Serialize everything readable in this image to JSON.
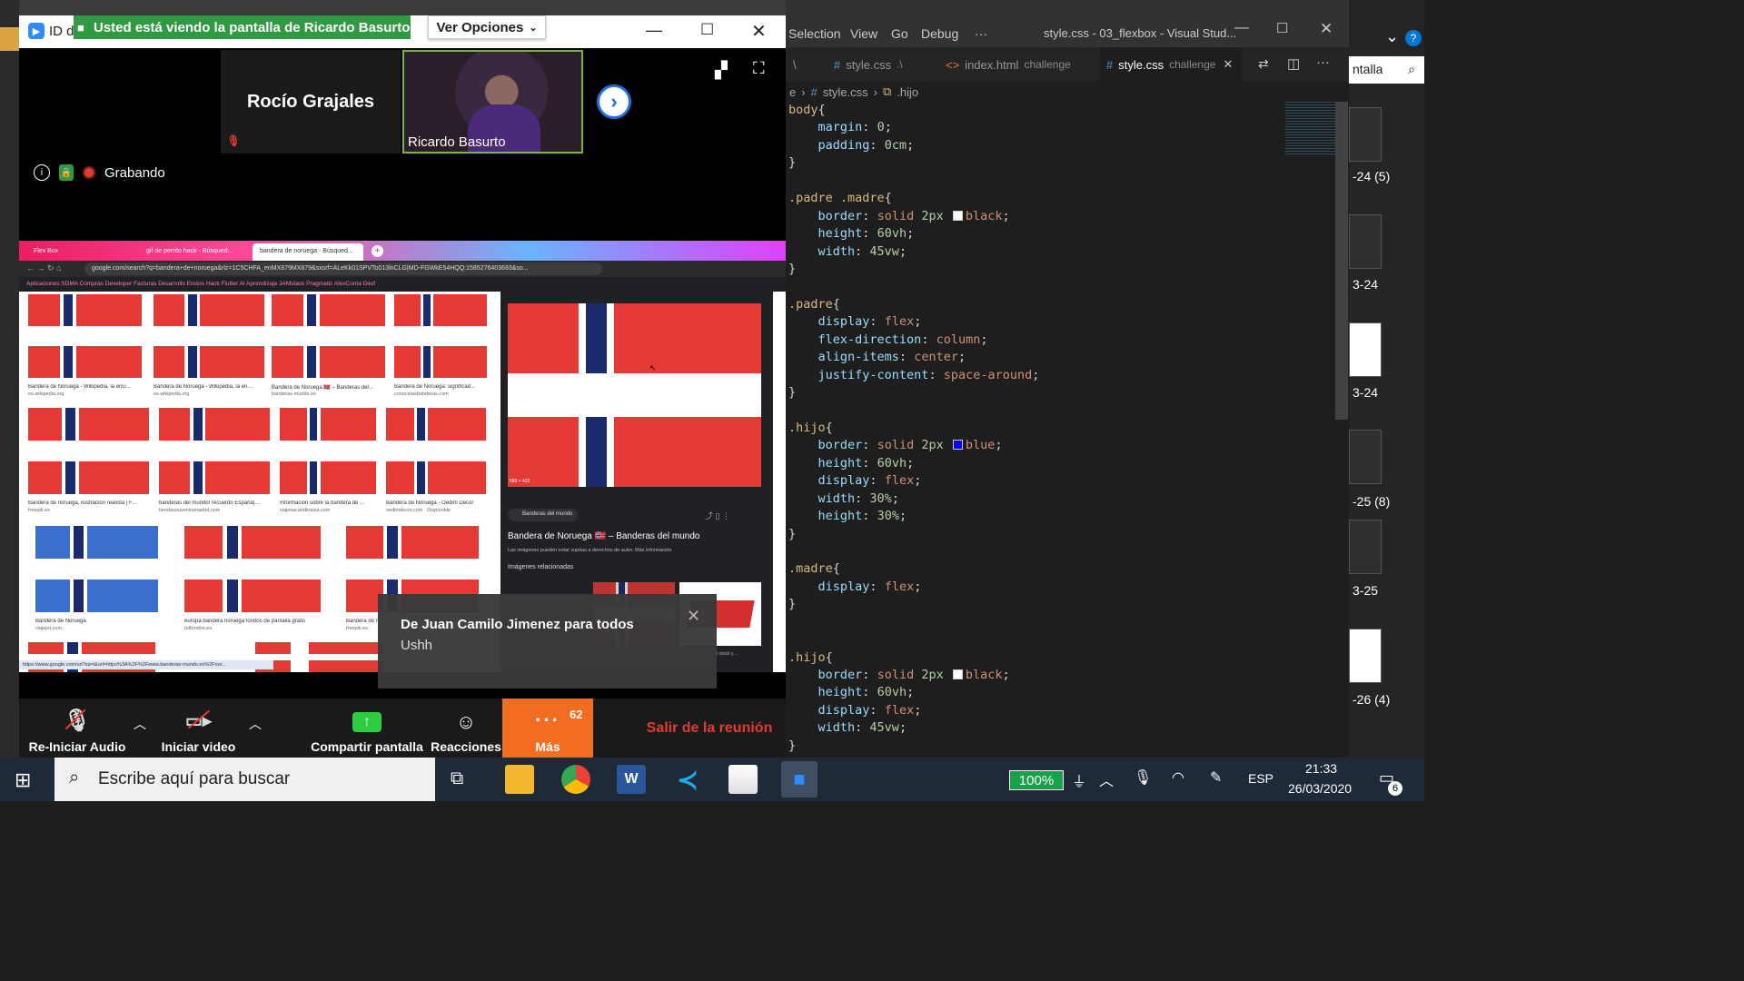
{
  "vscode": {
    "menu": [
      "Selection",
      "View",
      "Go",
      "Debug",
      "···"
    ],
    "title": "style.css - 03_flexbox - Visual Stud...",
    "tabs": [
      {
        "label": "\\",
        "desc": ""
      },
      {
        "label": "style.css",
        "desc": ".\\"
      },
      {
        "label": "index.html",
        "desc": "challenge"
      },
      {
        "label": "style.css",
        "desc": "challenge"
      }
    ],
    "breadcrumb": [
      "e",
      "style.css",
      ".hijo"
    ],
    "side_labels": [
      "ntalla",
      "-24 (5)",
      "3-24",
      "3-24",
      "-25 (8)",
      "3-25",
      "-26 (4)"
    ],
    "code": [
      [
        [
          "k",
          "body"
        ],
        [
          "w",
          "{"
        ]
      ],
      [
        [
          "w",
          "    "
        ],
        [
          "p",
          "margin"
        ],
        [
          "w",
          ": "
        ],
        [
          "n",
          "0"
        ],
        [
          "w",
          ";"
        ]
      ],
      [
        [
          "w",
          "    "
        ],
        [
          "p",
          "padding"
        ],
        [
          "w",
          ": "
        ],
        [
          "n",
          "0cm"
        ],
        [
          "w",
          ";"
        ]
      ],
      [
        [
          "w",
          "}"
        ]
      ],
      [
        [
          "w",
          ""
        ]
      ],
      [
        [
          "k",
          ".padre .madre"
        ],
        [
          "w",
          "{"
        ]
      ],
      [
        [
          "w",
          "    "
        ],
        [
          "p",
          "border"
        ],
        [
          "w",
          ": "
        ],
        [
          "v",
          "solid "
        ],
        [
          "n",
          "2px "
        ],
        [
          "sw",
          "#ffffff"
        ],
        [
          "v",
          "black"
        ],
        [
          "w",
          ";"
        ]
      ],
      [
        [
          "w",
          "    "
        ],
        [
          "p",
          "height"
        ],
        [
          "w",
          ": "
        ],
        [
          "n",
          "60vh"
        ],
        [
          "w",
          ";"
        ]
      ],
      [
        [
          "w",
          "    "
        ],
        [
          "p",
          "width"
        ],
        [
          "w",
          ": "
        ],
        [
          "n",
          "45vw"
        ],
        [
          "w",
          ";"
        ]
      ],
      [
        [
          "w",
          "}"
        ]
      ],
      [
        [
          "w",
          ""
        ]
      ],
      [
        [
          "k",
          ".padre"
        ],
        [
          "w",
          "{"
        ]
      ],
      [
        [
          "w",
          "    "
        ],
        [
          "p",
          "display"
        ],
        [
          "w",
          ": "
        ],
        [
          "v",
          "flex"
        ],
        [
          "w",
          ";"
        ]
      ],
      [
        [
          "w",
          "    "
        ],
        [
          "p",
          "flex-direction"
        ],
        [
          "w",
          ": "
        ],
        [
          "v",
          "column"
        ],
        [
          "w",
          ";"
        ]
      ],
      [
        [
          "w",
          "    "
        ],
        [
          "p",
          "align-items"
        ],
        [
          "w",
          ": "
        ],
        [
          "v",
          "center"
        ],
        [
          "w",
          ";"
        ]
      ],
      [
        [
          "w",
          "    "
        ],
        [
          "p",
          "justify-content"
        ],
        [
          "w",
          ": "
        ],
        [
          "v",
          "space-around"
        ],
        [
          "w",
          ";"
        ]
      ],
      [
        [
          "w",
          "}"
        ]
      ],
      [
        [
          "w",
          ""
        ]
      ],
      [
        [
          "k",
          ".hijo"
        ],
        [
          "w",
          "{"
        ]
      ],
      [
        [
          "w",
          "    "
        ],
        [
          "p",
          "border"
        ],
        [
          "w",
          ": "
        ],
        [
          "v",
          "solid "
        ],
        [
          "n",
          "2px "
        ],
        [
          "sw",
          "#0000ff"
        ],
        [
          "v",
          "blue"
        ],
        [
          "w",
          ";"
        ]
      ],
      [
        [
          "w",
          "    "
        ],
        [
          "p",
          "height"
        ],
        [
          "w",
          ": "
        ],
        [
          "n",
          "60vh"
        ],
        [
          "w",
          ";"
        ]
      ],
      [
        [
          "w",
          "    "
        ],
        [
          "p",
          "display"
        ],
        [
          "w",
          ": "
        ],
        [
          "v",
          "flex"
        ],
        [
          "w",
          ";"
        ]
      ],
      [
        [
          "w",
          "    "
        ],
        [
          "p",
          "width"
        ],
        [
          "w",
          ": "
        ],
        [
          "n",
          "30%"
        ],
        [
          "w",
          ";"
        ]
      ],
      [
        [
          "w",
          "    "
        ],
        [
          "p",
          "height"
        ],
        [
          "w",
          ": "
        ],
        [
          "n",
          "30%"
        ],
        [
          "w",
          ";"
        ]
      ],
      [
        [
          "w",
          "}"
        ]
      ],
      [
        [
          "w",
          ""
        ]
      ],
      [
        [
          "k",
          ".madre"
        ],
        [
          "w",
          "{"
        ]
      ],
      [
        [
          "w",
          "    "
        ],
        [
          "p",
          "display"
        ],
        [
          "w",
          ": "
        ],
        [
          "v",
          "flex"
        ],
        [
          "w",
          ";"
        ]
      ],
      [
        [
          "w",
          "}"
        ]
      ],
      [
        [
          "w",
          ""
        ]
      ],
      [
        [
          "w",
          ""
        ]
      ],
      [
        [
          "k",
          ".hijo"
        ],
        [
          "w",
          "{"
        ]
      ],
      [
        [
          "w",
          "    "
        ],
        [
          "p",
          "border"
        ],
        [
          "w",
          ": "
        ],
        [
          "v",
          "solid "
        ],
        [
          "n",
          "2px "
        ],
        [
          "sw",
          "#ffffff"
        ],
        [
          "v",
          "black"
        ],
        [
          "w",
          ";"
        ]
      ],
      [
        [
          "w",
          "    "
        ],
        [
          "p",
          "height"
        ],
        [
          "w",
          ": "
        ],
        [
          "n",
          "60vh"
        ],
        [
          "w",
          ";"
        ]
      ],
      [
        [
          "w",
          "    "
        ],
        [
          "p",
          "display"
        ],
        [
          "w",
          ": "
        ],
        [
          "v",
          "flex"
        ],
        [
          "w",
          ";"
        ]
      ],
      [
        [
          "w",
          "    "
        ],
        [
          "p",
          "width"
        ],
        [
          "w",
          ": "
        ],
        [
          "n",
          "45vw"
        ],
        [
          "w",
          ";"
        ]
      ],
      [
        [
          "w",
          "}"
        ]
      ]
    ]
  },
  "zoom": {
    "window_title": "ID d",
    "banner": "Usted está viendo la pantalla de Ricardo Basurto",
    "options_button": "Ver Opciones",
    "participants": [
      {
        "name": "Rocío Grajales"
      },
      {
        "name": "Ricardo Basurto"
      }
    ],
    "recording": "Grabando",
    "toolbar": {
      "audio": "Re-Iniciar Audio",
      "video": "Iniciar video",
      "share": "Compartir pantalla",
      "reactions": "Reacciones",
      "more": "Más",
      "more_badge": "62",
      "leave": "Salir de la reunión"
    },
    "chat_toast": {
      "from": "De Juan Camilo Jimenez para todos",
      "message": "Ushh"
    }
  },
  "shared_browser": {
    "tabs": [
      "Flex Box",
      "gif de perrito hack - Búsqued...",
      "bandera de noruega - Búsqued..."
    ],
    "url": "google.com/search?q=bandera+de+noruega&rlz=1C5CHFA_enMX879MX879&sxsrf=ALeKk01SPVTo013lnCLG|MD-FGWkE54HQQ:1585276403683&so...",
    "bookmarks": "Aplicaciones   SDMA   Compras   Developer   Facturas   Desarrollo   Envios   Hack   Flutter   AI   Aprendizaje   JAMstack   Pragmatic   AlexConta   Devf",
    "results": [
      {
        "title": "Bandera de Noruega - Wikipedia, la enci...",
        "src": "es.wikipedia.org"
      },
      {
        "title": "Bandera de Noruega - Wikipedia, la en...",
        "src": "es.wikipedia.org"
      },
      {
        "title": "Bandera de Noruega 🇳🇴 – Banderas del...",
        "src": "banderas-mundo.es"
      },
      {
        "title": "Bandera de Noruega: significad...",
        "src": "conocelasbanderas.com"
      },
      {
        "title": "Bandera de noruega, ilustración realista | F...",
        "src": "freepik.es"
      },
      {
        "title": "banderas del mundo! recuerdo España|...",
        "src": "tiendasouvenirsmadrid.com"
      },
      {
        "title": "Información sobre la bandera de ...",
        "src": "viajesacandinavia.com"
      },
      {
        "title": "Bandera de Noruega - Oedim Decor",
        "src": "oedimdecor.com · Disponible"
      },
      {
        "title": "Bandera de Noruega",
        "src": "viajejet.com"
      },
      {
        "title": "europa bandera noruega fondos de pantalla gratis",
        "src": "hdfondos.eu"
      },
      {
        "title": "Bandera de no...",
        "src": "freepik.es"
      }
    ],
    "panel": {
      "dims": "580 × 422",
      "source": "Banderas del mundo",
      "title": "Bandera de Noruega 🇳🇴 – Banderas del mundo",
      "rights": "Las imágenes pueden estar sujetas a derechos de autor. Más información",
      "related": "Imágenes relacionadas",
      "related_caption": "Imágenes, fotos de stock y ..."
    },
    "status_url": "https://www.google.com/url?sa=i&url=https%3A%2F%2Fwww.banderas-mundo.es%2Fnor..."
  },
  "taskbar": {
    "search_placeholder": "Escribe aquí para buscar",
    "battery": "100%",
    "language": "ESP",
    "time": "21:33",
    "date": "26/03/2020",
    "notifications": "6"
  }
}
